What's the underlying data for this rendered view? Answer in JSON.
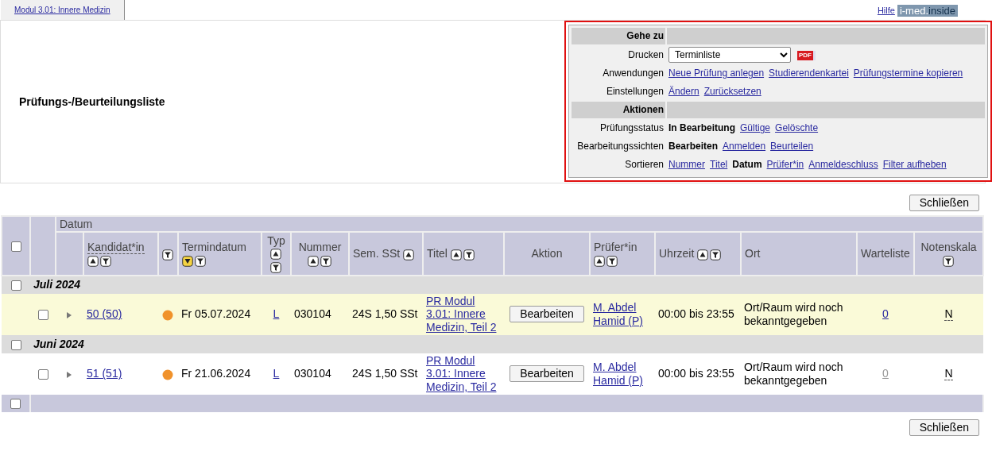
{
  "tabs": [
    {
      "label": "Modul 3.01: Innere Medizin",
      "selected": true
    }
  ],
  "help_link": "Hilfe",
  "logo": [
    "i-med.",
    "inside"
  ],
  "page_title": "Prüfungs-/Beurteilungsliste",
  "options_panel": [
    {
      "heading": "Gehe zu",
      "rows": [
        {
          "label": "Drucken",
          "kind": "select",
          "value": "Terminliste",
          "icon_label": "PDF"
        },
        {
          "label": "Anwendungen",
          "kind": "links",
          "items": [
            {
              "text": "Neue Prüfung anlegen",
              "selected": false
            },
            {
              "text": "Studierendenkartei",
              "selected": false
            },
            {
              "text": "Prüfungstermine kopieren",
              "selected": false
            }
          ]
        },
        {
          "label": "Einstellungen",
          "kind": "links",
          "items": [
            {
              "text": "Ändern",
              "selected": false
            },
            {
              "text": "Zurücksetzen",
              "selected": false
            }
          ]
        }
      ]
    },
    {
      "heading": "Aktionen",
      "rows": [
        {
          "label": "Prüfungsstatus",
          "kind": "links",
          "items": [
            {
              "text": "In Bearbeitung",
              "selected": true
            },
            {
              "text": "Gültige",
              "selected": false
            },
            {
              "text": "Gelöschte",
              "selected": false
            }
          ]
        },
        {
          "label": "Bearbeitungssichten",
          "kind": "links",
          "items": [
            {
              "text": "Bearbeiten",
              "selected": true
            },
            {
              "text": "Anmelden",
              "selected": false
            },
            {
              "text": "Beurteilen",
              "selected": false
            }
          ]
        },
        {
          "label": "Sortieren",
          "kind": "links",
          "items": [
            {
              "text": "Nummer",
              "selected": false
            },
            {
              "text": "Titel",
              "selected": false
            },
            {
              "text": "Datum",
              "selected": true
            },
            {
              "text": "Prüfer*in",
              "selected": false
            },
            {
              "text": "Anmeldeschluss",
              "selected": false
            },
            {
              "text": "Filter aufheben",
              "selected": false
            }
          ]
        }
      ]
    }
  ],
  "close_button_top": "Schließen",
  "table": {
    "select_all_checked": false,
    "group_header": "Datum",
    "columns": [
      {},
      {
        "label": "Kandidat*in",
        "sort": true,
        "filter": true
      },
      {
        "filter": true
      },
      {
        "label": "Termindatum",
        "sort": true,
        "sort_descending": true,
        "filter": true
      },
      {
        "label": "Typ",
        "sort": true,
        "filter": true
      },
      {
        "label": "Nummer",
        "sort": true,
        "filter": true
      },
      {
        "label": "Sem. SSt",
        "sort": true
      },
      {
        "label": "Titel",
        "sort": true,
        "filter": true
      },
      {
        "label": "Aktion"
      },
      {
        "label": "Prüfer*in",
        "sort": true,
        "filter": true
      },
      {
        "label": "Uhrzeit",
        "sort": true,
        "filter": true
      },
      {
        "label": "Ort"
      },
      {
        "label": "Warteliste"
      },
      {
        "label": "Notenskala",
        "filter": true
      }
    ],
    "groups": [
      {
        "label": "Juli 2024",
        "checked": false,
        "rows": [
          {
            "checked": false,
            "highlighted": true,
            "candidates": "50 (50)",
            "color": "#f0922b",
            "date": "Fr 05.07.2024",
            "type": "L",
            "number": "030104",
            "sem_sst": "24S 1,50 SSt",
            "title": "PR Modul 3.01: Innere Medizin, Teil 2",
            "action": "Bearbeiten",
            "examiner": "M. Abdel Hamid (P)",
            "time": "00:00 bis 23:55",
            "location": "Ort/Raum wird noch bekanntgegeben",
            "waitlist": "0",
            "waitlist_disabled": false,
            "grade_scale": "N"
          }
        ]
      },
      {
        "label": "Juni 2024",
        "checked": false,
        "rows": [
          {
            "checked": false,
            "highlighted": false,
            "candidates": "51 (51)",
            "color": "#f0922b",
            "date": "Fr 21.06.2024",
            "type": "L",
            "number": "030104",
            "sem_sst": "24S 1,50 SSt",
            "title": "PR Modul 3.01: Innere Medizin, Teil 2",
            "action": "Bearbeiten",
            "examiner": "M. Abdel Hamid (P)",
            "time": "00:00 bis 23:55",
            "location": "Ort/Raum wird noch bekanntgegeben",
            "waitlist": "0",
            "waitlist_disabled": true,
            "grade_scale": "N"
          }
        ]
      }
    ],
    "footer_checked": false
  },
  "close_button_bottom": "Schließen"
}
